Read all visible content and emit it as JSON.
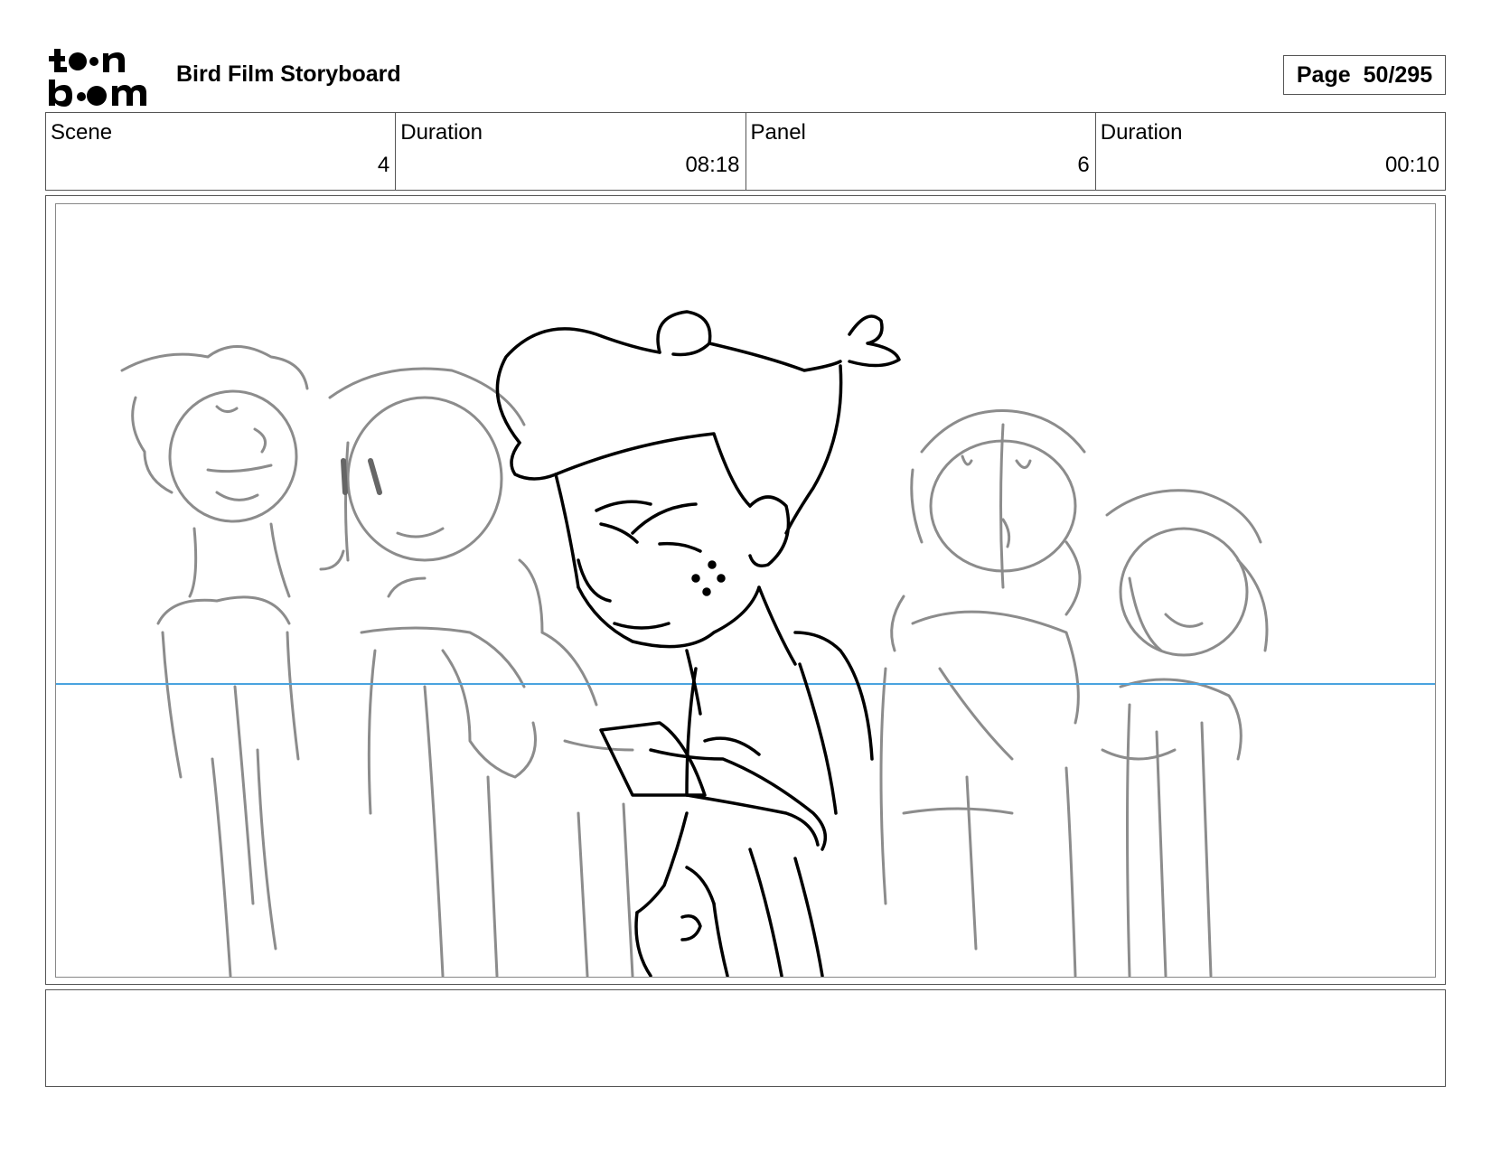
{
  "header": {
    "logo_text": "toonboom",
    "title": "Bird Film Storyboard",
    "page_label": "Page",
    "page_value": "50/295"
  },
  "info": [
    {
      "label": "Scene",
      "value": "4"
    },
    {
      "label": "Duration",
      "value": "08:18"
    },
    {
      "label": "Panel",
      "value": "6"
    },
    {
      "label": "Duration",
      "value": "00:10"
    }
  ],
  "panel": {
    "image_name": "storyboard-sketch",
    "horizon_color": "#4aa3df",
    "foreground_line_color": "#000000",
    "background_line_color": "#8c8c8c"
  },
  "notes": {
    "text": ""
  }
}
